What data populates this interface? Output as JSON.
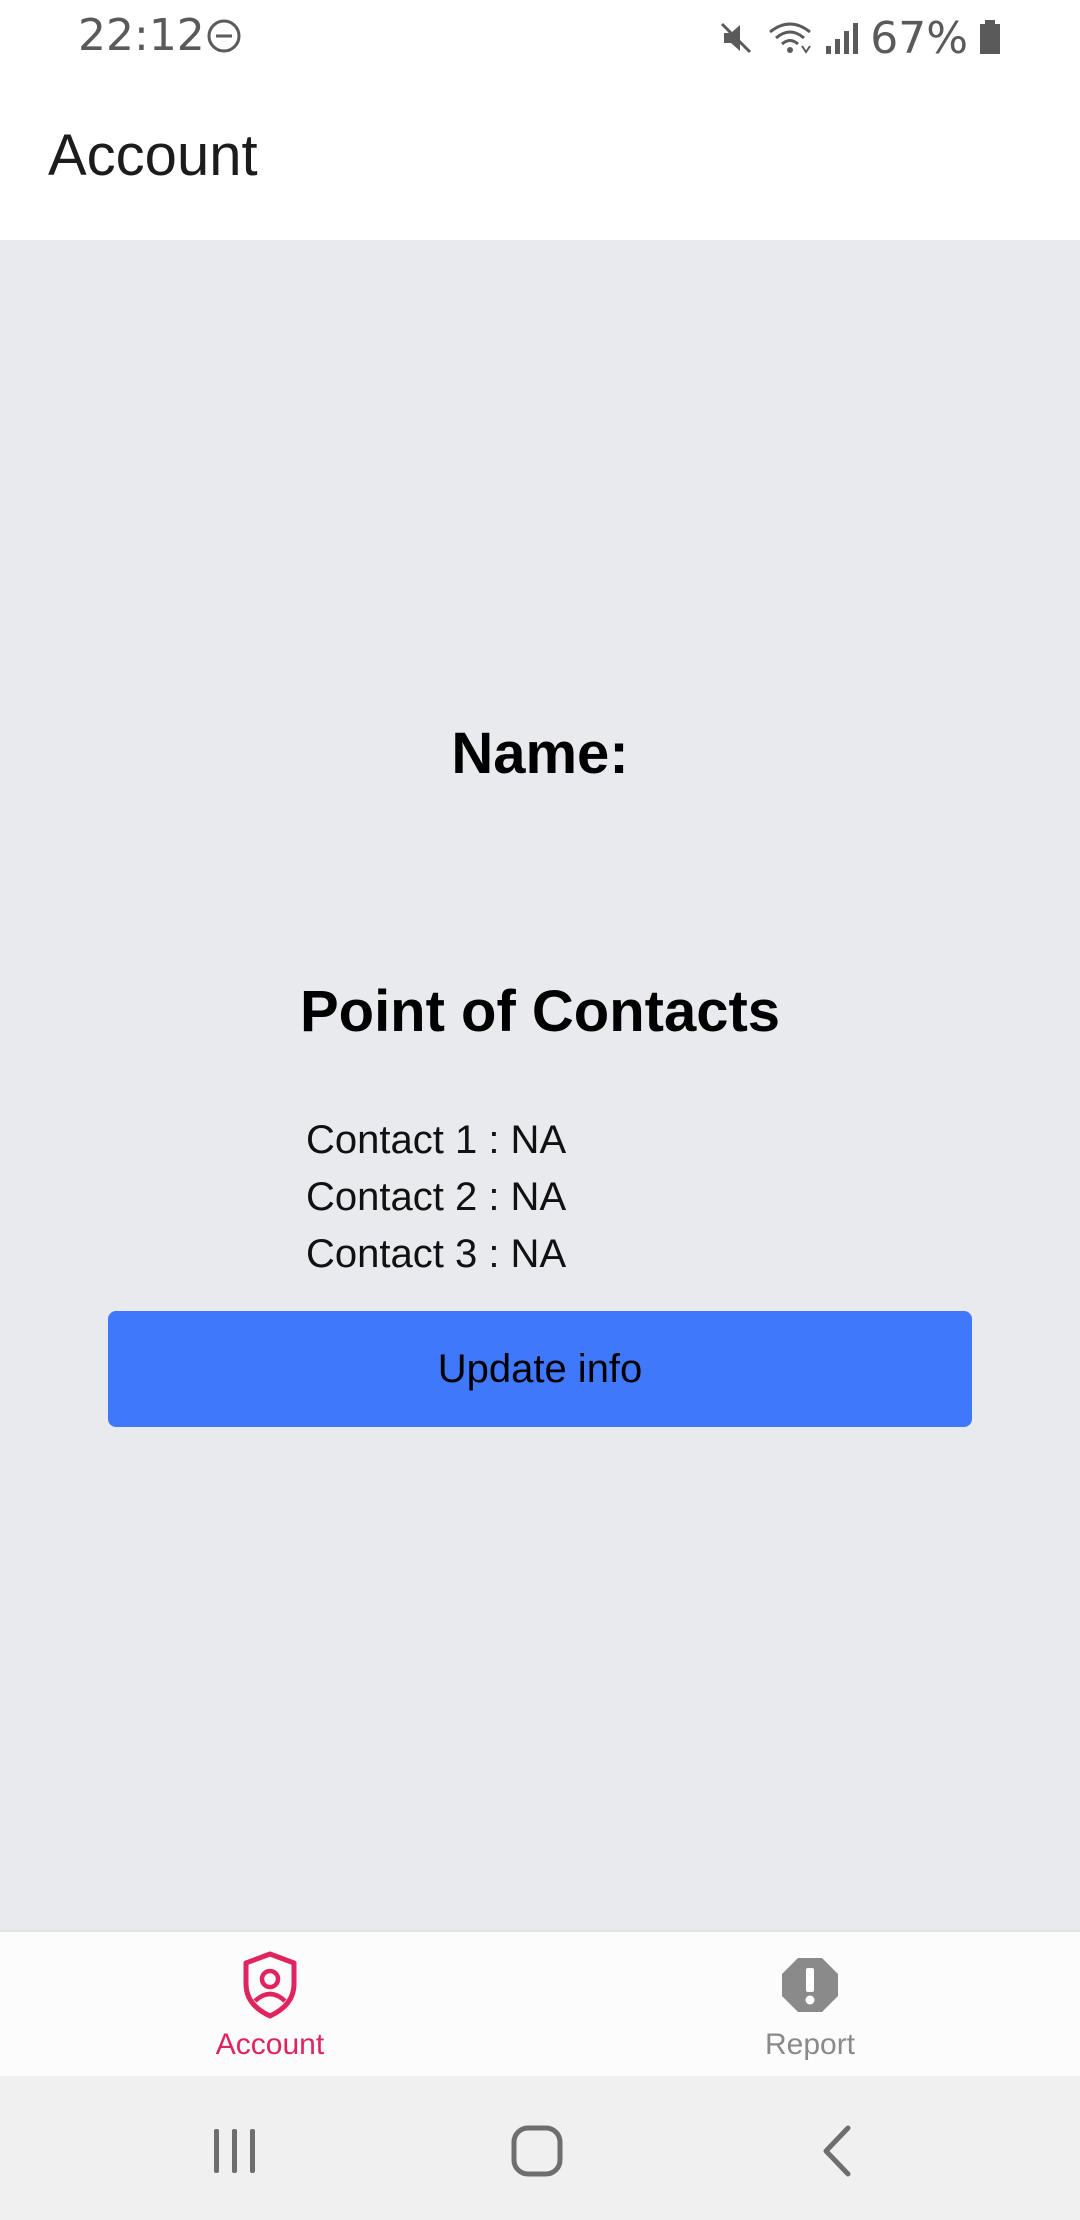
{
  "status_bar": {
    "time": "22:12",
    "battery": "67%",
    "icons": [
      "do-not-disturb-icon",
      "mute-icon",
      "wifi-icon",
      "signal-icon",
      "battery-icon"
    ]
  },
  "app_bar": {
    "title": "Account"
  },
  "main": {
    "name_label": "Name:",
    "poc_title": "Point of Contacts",
    "contacts": [
      "Contact 1 : NA",
      "Contact 2 : NA",
      "Contact 3 : NA"
    ],
    "update_button": "Update info"
  },
  "tab_bar": {
    "tabs": [
      {
        "label": "Account",
        "icon": "account-shield-icon",
        "active": true
      },
      {
        "label": "Report",
        "icon": "report-alert-icon",
        "active": false
      }
    ]
  },
  "colors": {
    "accent": "#e0245e",
    "button": "#4078fc",
    "inactive_tab": "#8a8a8a",
    "background": "#e9eaee"
  },
  "nav_bar": {
    "buttons": [
      "recents-icon",
      "home-icon",
      "back-icon"
    ]
  }
}
